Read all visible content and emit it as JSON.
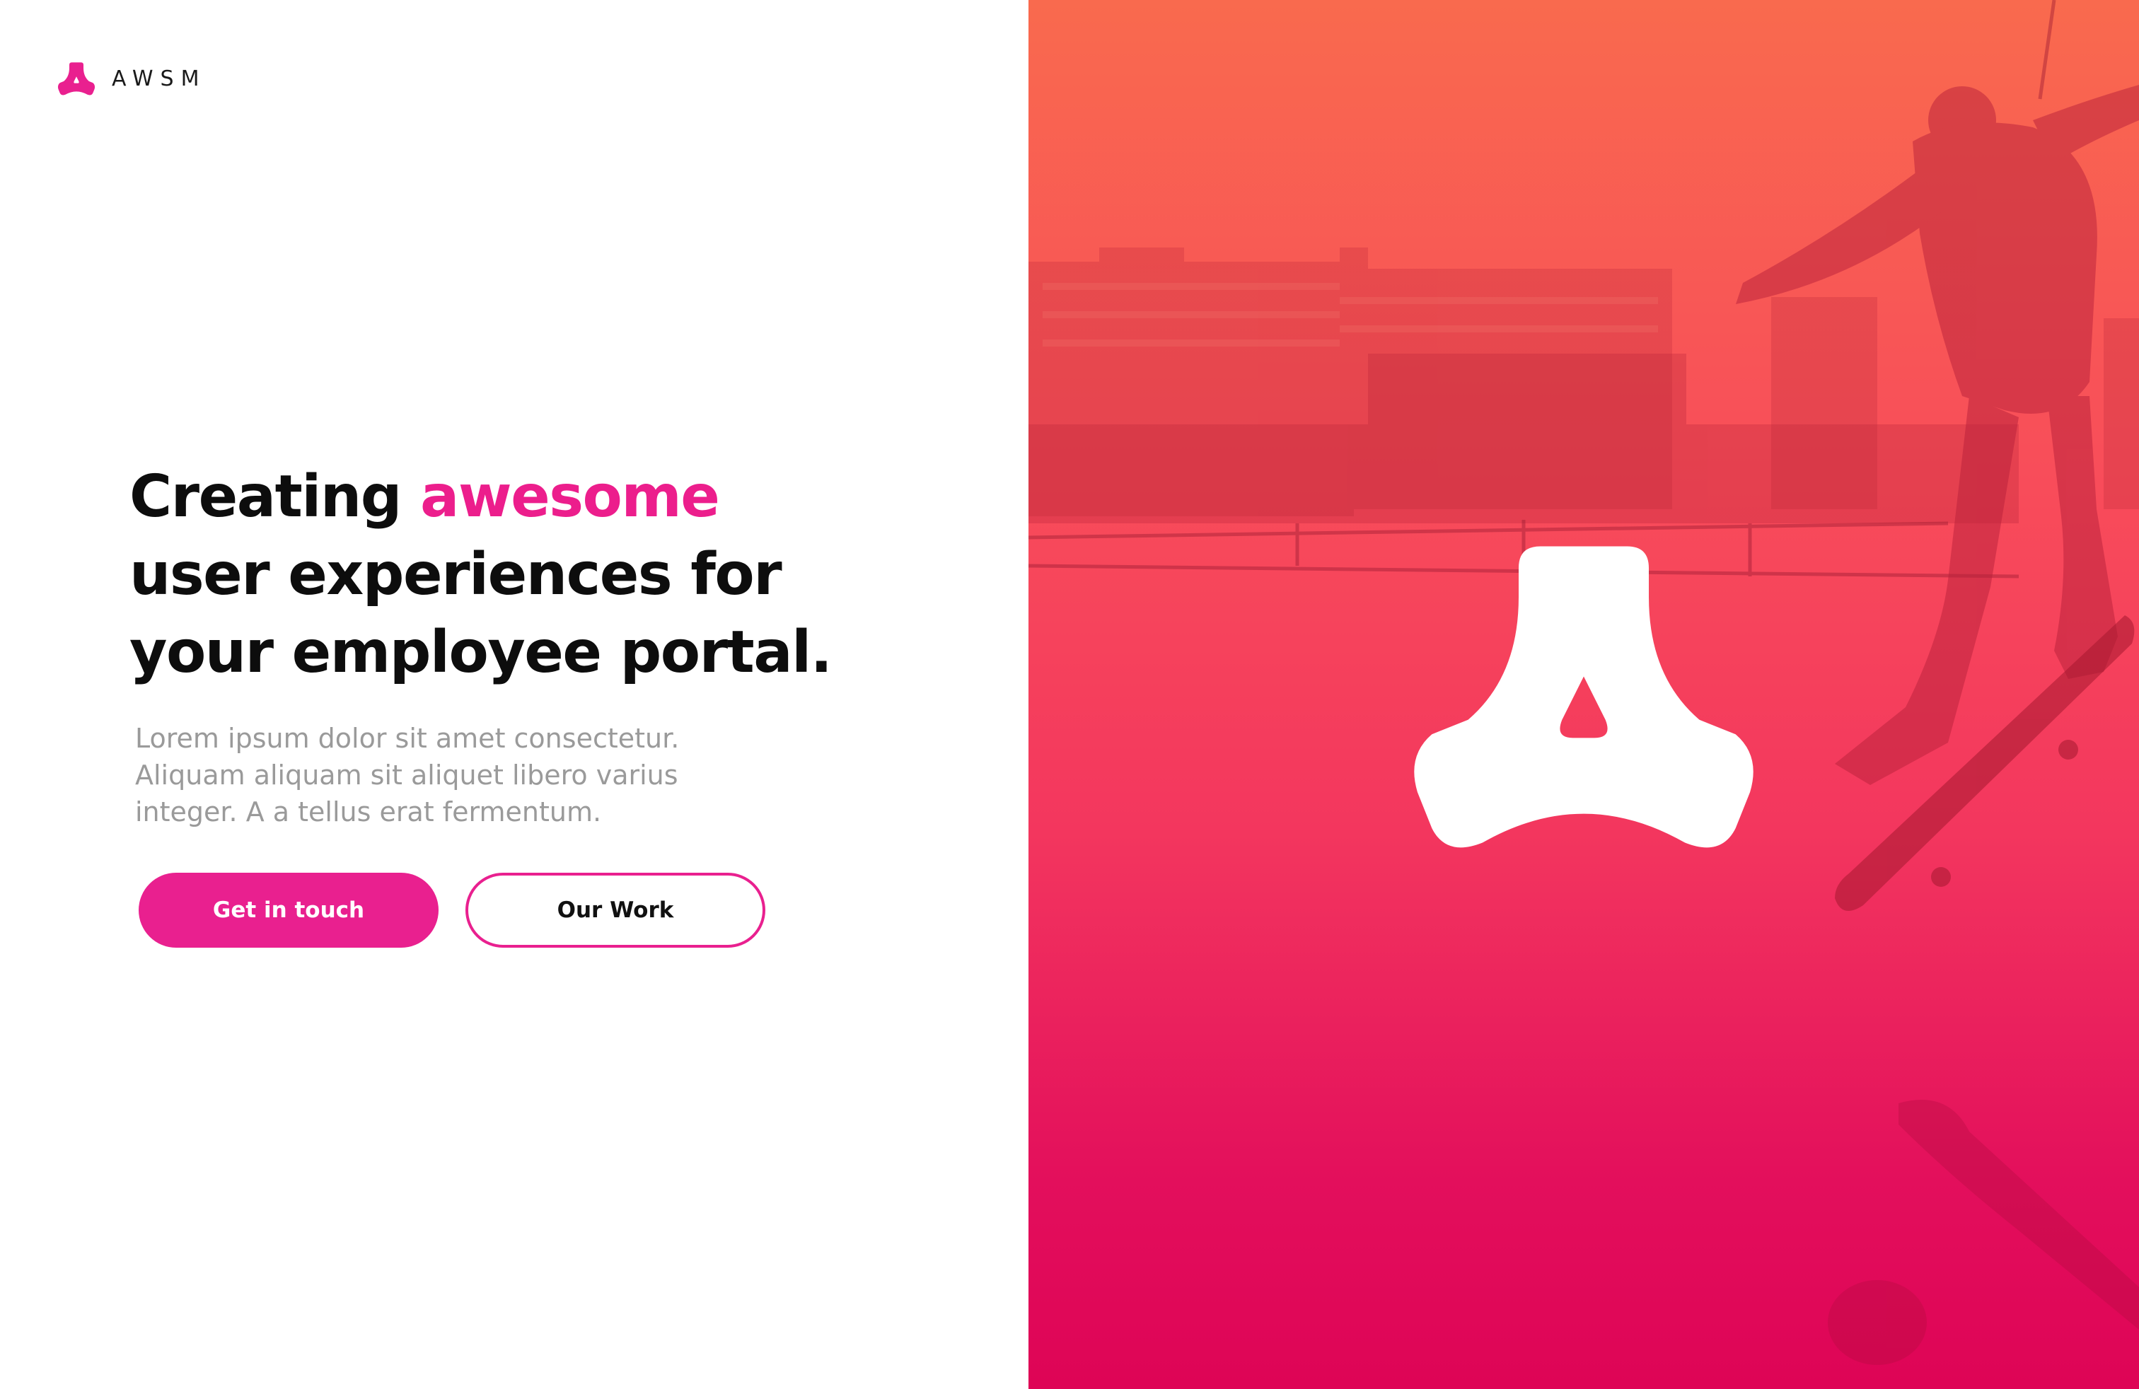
{
  "brand": {
    "name": "AWSM",
    "logo_icon": "awsm-triskelion-logo-icon",
    "accent_color": "#e9208f"
  },
  "hero": {
    "title_prefix": "Creating",
    "title_accent": "awesome",
    "title_line2": "user experiences for",
    "title_line3": "your employee portal.",
    "description": "Lorem ipsum dolor sit amet consectetur. Aliquam aliquam sit aliquet libero varius integer. A a tellus erat fermentum."
  },
  "actions": {
    "primary_label": "Get in touch",
    "secondary_label": "Our Work"
  },
  "visual": {
    "background_gradient": [
      "#f96a4e",
      "#f84c5a",
      "#f3365e",
      "#e30f5c",
      "#de0456"
    ],
    "logo_color": "#ffffff",
    "logo_icon": "awsm-triskelion-logo-icon"
  }
}
